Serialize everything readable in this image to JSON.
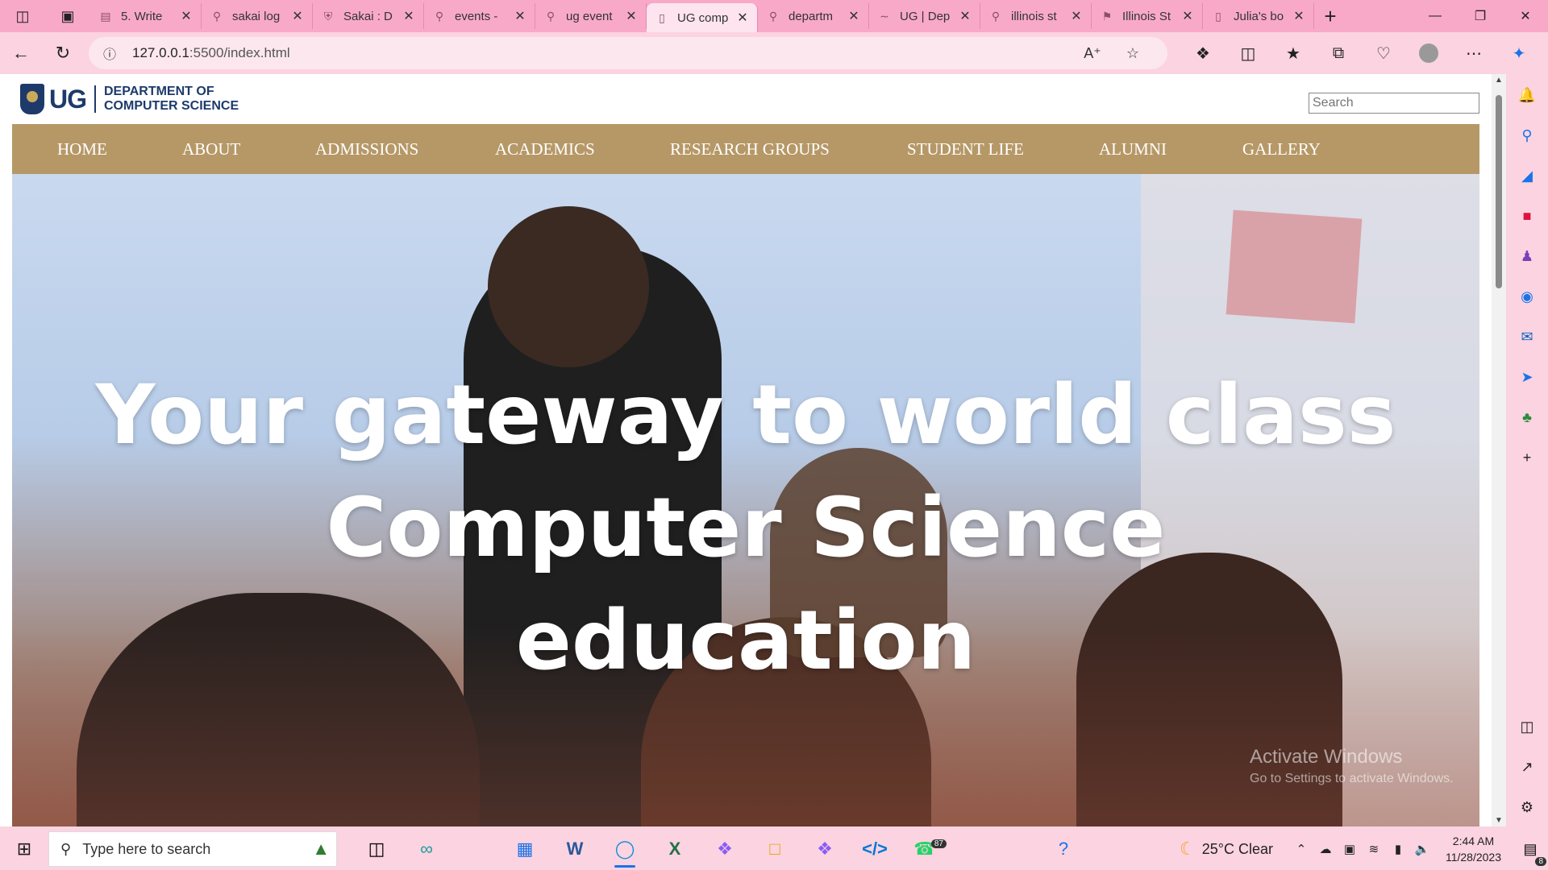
{
  "browser": {
    "tabs": [
      {
        "label": "5. Write",
        "icon": "document-icon"
      },
      {
        "label": "sakai log",
        "icon": "search-icon"
      },
      {
        "label": "Sakai : D",
        "icon": "crest-icon"
      },
      {
        "label": "events -",
        "icon": "search-icon"
      },
      {
        "label": "ug event",
        "icon": "search-icon"
      },
      {
        "label": "UG comp",
        "icon": "page-icon",
        "active": true
      },
      {
        "label": "departm",
        "icon": "search-icon"
      },
      {
        "label": "UG | Dep",
        "icon": "link-icon"
      },
      {
        "label": "illinois st",
        "icon": "search-icon"
      },
      {
        "label": "Illinois St",
        "icon": "flag-icon"
      },
      {
        "label": "Julia's bo",
        "icon": "page-icon"
      }
    ],
    "url_host": "127.0.0.1",
    "url_rest": ":5500/index.html"
  },
  "site": {
    "logo_short": "UG",
    "dept_line1": "DEPARTMENT OF",
    "dept_line2": "COMPUTER SCIENCE",
    "search_placeholder": "Search",
    "nav": [
      "HOME",
      "ABOUT",
      "ADMISSIONS",
      "ACADEMICS",
      "RESEARCH GROUPS",
      "STUDENT LIFE",
      "ALUMNI",
      "GALLERY"
    ],
    "hero_line1": "Your gateway to world class",
    "hero_line2": "Computer Science",
    "hero_line3": "education",
    "watermark_title": "Activate Windows",
    "watermark_sub": "Go to Settings to activate Windows."
  },
  "taskbar": {
    "search_placeholder": "Type here to search",
    "weather": "25°C  Clear",
    "time": "2:44 AM",
    "date": "11/28/2023",
    "whatsapp_badge": "87",
    "notification_count": "8"
  },
  "colors": {
    "nav_bg": "#b69867",
    "brand_blue": "#1d3a6b",
    "chrome_pink": "#f9a9c8"
  }
}
